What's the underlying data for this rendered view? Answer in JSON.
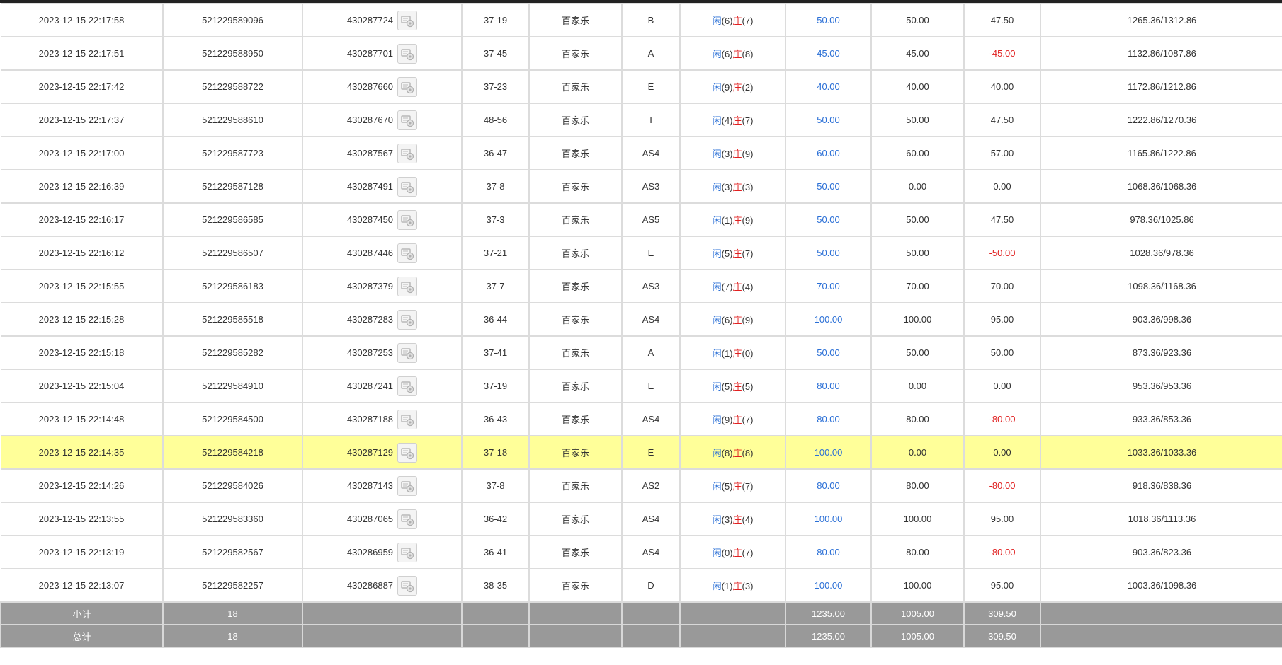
{
  "colors": {
    "highlight_row": "#ffff99",
    "summary_bg": "#999999",
    "blue_value": "#2a6fd6",
    "red_value": "#e02020"
  },
  "records": [
    {
      "time": "2023-12-15 22:17:58",
      "bet_id": "521229589096",
      "round_id": "430287724",
      "shoe": "37-19",
      "game": "百家乐",
      "table": "B",
      "result": {
        "player_label": "闲",
        "player": "(6)",
        "banker_label": "庄",
        "banker": "(7)"
      },
      "bet": "50.00",
      "valid": "50.00",
      "win": "47.50",
      "win_negative": false,
      "balance": "1265.36/1312.86",
      "highlight": false
    },
    {
      "time": "2023-12-15 22:17:51",
      "bet_id": "521229588950",
      "round_id": "430287701",
      "shoe": "37-45",
      "game": "百家乐",
      "table": "A",
      "result": {
        "player_label": "闲",
        "player": "(6)",
        "banker_label": "庄",
        "banker": "(8)"
      },
      "bet": "45.00",
      "valid": "45.00",
      "win": "-45.00",
      "win_negative": true,
      "balance": "1132.86/1087.86",
      "highlight": false
    },
    {
      "time": "2023-12-15 22:17:42",
      "bet_id": "521229588722",
      "round_id": "430287660",
      "shoe": "37-23",
      "game": "百家乐",
      "table": "E",
      "result": {
        "player_label": "闲",
        "player": "(9)",
        "banker_label": "庄",
        "banker": "(2)"
      },
      "bet": "40.00",
      "valid": "40.00",
      "win": "40.00",
      "win_negative": false,
      "balance": "1172.86/1212.86",
      "highlight": false
    },
    {
      "time": "2023-12-15 22:17:37",
      "bet_id": "521229588610",
      "round_id": "430287670",
      "shoe": "48-56",
      "game": "百家乐",
      "table": "I",
      "result": {
        "player_label": "闲",
        "player": "(4)",
        "banker_label": "庄",
        "banker": "(7)"
      },
      "bet": "50.00",
      "valid": "50.00",
      "win": "47.50",
      "win_negative": false,
      "balance": "1222.86/1270.36",
      "highlight": false
    },
    {
      "time": "2023-12-15 22:17:00",
      "bet_id": "521229587723",
      "round_id": "430287567",
      "shoe": "36-47",
      "game": "百家乐",
      "table": "AS4",
      "result": {
        "player_label": "闲",
        "player": "(3)",
        "banker_label": "庄",
        "banker": "(9)"
      },
      "bet": "60.00",
      "valid": "60.00",
      "win": "57.00",
      "win_negative": false,
      "balance": "1165.86/1222.86",
      "highlight": false
    },
    {
      "time": "2023-12-15 22:16:39",
      "bet_id": "521229587128",
      "round_id": "430287491",
      "shoe": "37-8",
      "game": "百家乐",
      "table": "AS3",
      "result": {
        "player_label": "闲",
        "player": "(3)",
        "banker_label": "庄",
        "banker": "(3)"
      },
      "bet": "50.00",
      "valid": "0.00",
      "win": "0.00",
      "win_negative": false,
      "balance": "1068.36/1068.36",
      "highlight": false
    },
    {
      "time": "2023-12-15 22:16:17",
      "bet_id": "521229586585",
      "round_id": "430287450",
      "shoe": "37-3",
      "game": "百家乐",
      "table": "AS5",
      "result": {
        "player_label": "闲",
        "player": "(1)",
        "banker_label": "庄",
        "banker": "(9)"
      },
      "bet": "50.00",
      "valid": "50.00",
      "win": "47.50",
      "win_negative": false,
      "balance": "978.36/1025.86",
      "highlight": false
    },
    {
      "time": "2023-12-15 22:16:12",
      "bet_id": "521229586507",
      "round_id": "430287446",
      "shoe": "37-21",
      "game": "百家乐",
      "table": "E",
      "result": {
        "player_label": "闲",
        "player": "(5)",
        "banker_label": "庄",
        "banker": "(7)"
      },
      "bet": "50.00",
      "valid": "50.00",
      "win": "-50.00",
      "win_negative": true,
      "balance": "1028.36/978.36",
      "highlight": false
    },
    {
      "time": "2023-12-15 22:15:55",
      "bet_id": "521229586183",
      "round_id": "430287379",
      "shoe": "37-7",
      "game": "百家乐",
      "table": "AS3",
      "result": {
        "player_label": "闲",
        "player": "(7)",
        "banker_label": "庄",
        "banker": "(4)"
      },
      "bet": "70.00",
      "valid": "70.00",
      "win": "70.00",
      "win_negative": false,
      "balance": "1098.36/1168.36",
      "highlight": false
    },
    {
      "time": "2023-12-15 22:15:28",
      "bet_id": "521229585518",
      "round_id": "430287283",
      "shoe": "36-44",
      "game": "百家乐",
      "table": "AS4",
      "result": {
        "player_label": "闲",
        "player": "(6)",
        "banker_label": "庄",
        "banker": "(9)"
      },
      "bet": "100.00",
      "valid": "100.00",
      "win": "95.00",
      "win_negative": false,
      "balance": "903.36/998.36",
      "highlight": false
    },
    {
      "time": "2023-12-15 22:15:18",
      "bet_id": "521229585282",
      "round_id": "430287253",
      "shoe": "37-41",
      "game": "百家乐",
      "table": "A",
      "result": {
        "player_label": "闲",
        "player": "(1)",
        "banker_label": "庄",
        "banker": "(0)"
      },
      "bet": "50.00",
      "valid": "50.00",
      "win": "50.00",
      "win_negative": false,
      "balance": "873.36/923.36",
      "highlight": false
    },
    {
      "time": "2023-12-15 22:15:04",
      "bet_id": "521229584910",
      "round_id": "430287241",
      "shoe": "37-19",
      "game": "百家乐",
      "table": "E",
      "result": {
        "player_label": "闲",
        "player": "(5)",
        "banker_label": "庄",
        "banker": "(5)"
      },
      "bet": "80.00",
      "valid": "0.00",
      "win": "0.00",
      "win_negative": false,
      "balance": "953.36/953.36",
      "highlight": false
    },
    {
      "time": "2023-12-15 22:14:48",
      "bet_id": "521229584500",
      "round_id": "430287188",
      "shoe": "36-43",
      "game": "百家乐",
      "table": "AS4",
      "result": {
        "player_label": "闲",
        "player": "(9)",
        "banker_label": "庄",
        "banker": "(7)"
      },
      "bet": "80.00",
      "valid": "80.00",
      "win": "-80.00",
      "win_negative": true,
      "balance": "933.36/853.36",
      "highlight": false
    },
    {
      "time": "2023-12-15 22:14:35",
      "bet_id": "521229584218",
      "round_id": "430287129",
      "shoe": "37-18",
      "game": "百家乐",
      "table": "E",
      "result": {
        "player_label": "闲",
        "player": "(8)",
        "banker_label": "庄",
        "banker": "(8)"
      },
      "bet": "100.00",
      "valid": "0.00",
      "win": "0.00",
      "win_negative": false,
      "balance": "1033.36/1033.36",
      "highlight": true
    },
    {
      "time": "2023-12-15 22:14:26",
      "bet_id": "521229584026",
      "round_id": "430287143",
      "shoe": "37-8",
      "game": "百家乐",
      "table": "AS2",
      "result": {
        "player_label": "闲",
        "player": "(5)",
        "banker_label": "庄",
        "banker": "(7)"
      },
      "bet": "80.00",
      "valid": "80.00",
      "win": "-80.00",
      "win_negative": true,
      "balance": "918.36/838.36",
      "highlight": false
    },
    {
      "time": "2023-12-15 22:13:55",
      "bet_id": "521229583360",
      "round_id": "430287065",
      "shoe": "36-42",
      "game": "百家乐",
      "table": "AS4",
      "result": {
        "player_label": "闲",
        "player": "(3)",
        "banker_label": "庄",
        "banker": "(4)"
      },
      "bet": "100.00",
      "valid": "100.00",
      "win": "95.00",
      "win_negative": false,
      "balance": "1018.36/1113.36",
      "highlight": false
    },
    {
      "time": "2023-12-15 22:13:19",
      "bet_id": "521229582567",
      "round_id": "430286959",
      "shoe": "36-41",
      "game": "百家乐",
      "table": "AS4",
      "result": {
        "player_label": "闲",
        "player": "(0)",
        "banker_label": "庄",
        "banker": "(7)"
      },
      "bet": "80.00",
      "valid": "80.00",
      "win": "-80.00",
      "win_negative": true,
      "balance": "903.36/823.36",
      "highlight": false
    },
    {
      "time": "2023-12-15 22:13:07",
      "bet_id": "521229582257",
      "round_id": "430286887",
      "shoe": "38-35",
      "game": "百家乐",
      "table": "D",
      "result": {
        "player_label": "闲",
        "player": "(1)",
        "banker_label": "庄",
        "banker": "(3)"
      },
      "bet": "100.00",
      "valid": "100.00",
      "win": "95.00",
      "win_negative": false,
      "balance": "1003.36/1098.36",
      "highlight": false
    }
  ],
  "summary": {
    "subtotal": {
      "label": "小计",
      "count": "18",
      "bet": "1235.00",
      "valid": "1005.00",
      "win": "309.50"
    },
    "total": {
      "label": "总计",
      "count": "18",
      "bet": "1235.00",
      "valid": "1005.00",
      "win": "309.50"
    }
  },
  "icons": {
    "detail": "chip-detail-icon"
  }
}
